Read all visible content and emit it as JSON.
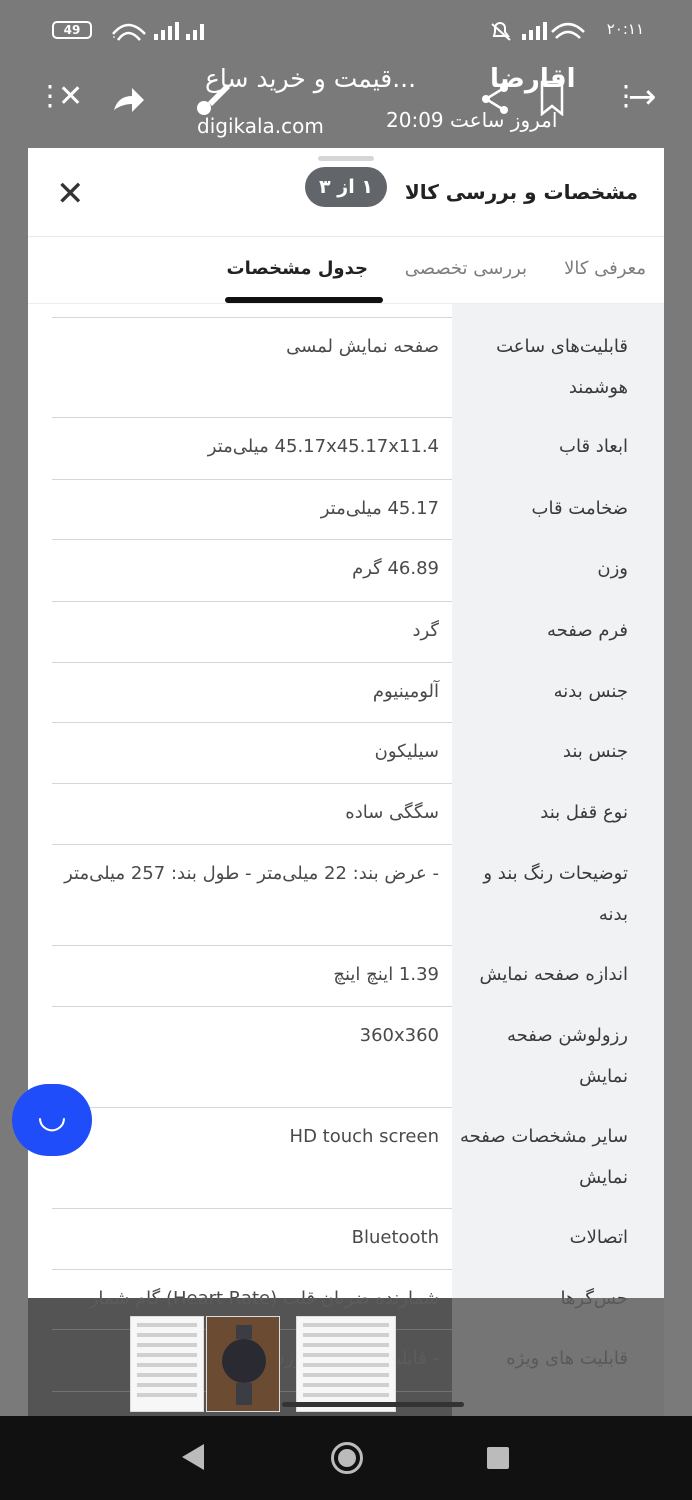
{
  "status_bar": {
    "battery": "49",
    "clock": "۲۰:۱۱"
  },
  "app_bar": {
    "title": "قیمت و خرید ساع...",
    "subtitle": "digikala.com",
    "sender": "اقارضا",
    "time": "امروز ساعت 20:09",
    "icons": [
      "more-vert-icon",
      "close-icon",
      "share-icon",
      "brush-icon",
      "share-nodes-icon",
      "bookmark-icon",
      "more-vert-icon",
      "forward-arrow-icon"
    ]
  },
  "sheet": {
    "title": "مشخصات و بررسی کالا",
    "page_indicator": "۱ از ۳",
    "tabs": [
      {
        "label": "معرفی کالا",
        "active": false
      },
      {
        "label": "بررسی تخصصی",
        "active": false
      },
      {
        "label": "جدول مشخصات",
        "active": true
      }
    ]
  },
  "specs": [
    {
      "key": "قابلیت‌های ساعت هوشمند",
      "value": "صفحه نمایش لمسی"
    },
    {
      "key": "ابعاد قاب",
      "value": "45.17x45.17x11.4 میلی‌متر"
    },
    {
      "key": "ضخامت قاب",
      "value": "45.17 میلی‌متر"
    },
    {
      "key": "وزن",
      "value": "46.89 گرم"
    },
    {
      "key": "فرم صفحه",
      "value": "گرد"
    },
    {
      "key": "جنس بدنه",
      "value": "آلومینیوم"
    },
    {
      "key": "جنس بند",
      "value": "سیلیکون"
    },
    {
      "key": "نوع قفل بند",
      "value": "سگگی ساده"
    },
    {
      "key": "توضیحات رنگ بند و بدنه",
      "value": "- عرض بند: 22 میلی‌متر - طول بند: 257 میلی‌متر"
    },
    {
      "key": "اندازه صفحه نمایش",
      "value": "1.39 اینچ اینچ"
    },
    {
      "key": "رزولوشن صفحه نمایش",
      "value": "360x360"
    },
    {
      "key": "سایر مشخصات صفحه نمایش",
      "value": "HD touch screen"
    },
    {
      "key": "اتصالات",
      "value": "Bluetooth"
    },
    {
      "key": "حس‌گرها",
      "value": "شمارنده ضربان قلب (Heart Rate) گام شمار"
    },
    {
      "key": "قابلیت های ویژه",
      "value": "- قابلیت ...AT... ورزشی"
    }
  ],
  "colors": {
    "accent": "#1f4dfa",
    "pill": "#62666a",
    "label_bg": "#f1f2f4"
  }
}
